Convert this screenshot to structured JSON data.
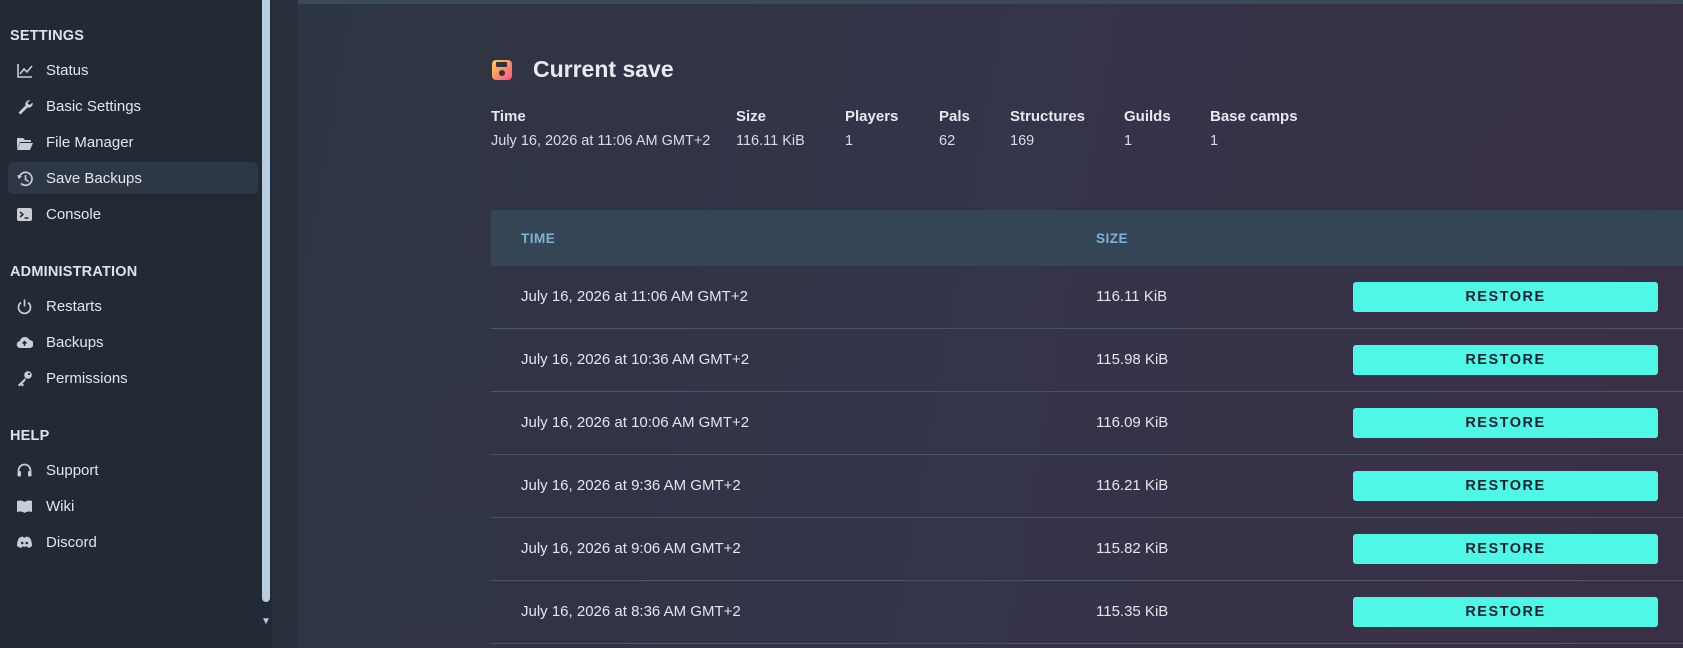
{
  "sidebar": {
    "sections": [
      {
        "title": "SETTINGS",
        "items": [
          {
            "label": "Status",
            "icon": "chart-line-icon"
          },
          {
            "label": "Basic Settings",
            "icon": "wrench-icon"
          },
          {
            "label": "File Manager",
            "icon": "folder-open-icon"
          },
          {
            "label": "Save Backups",
            "icon": "history-icon",
            "active": true
          },
          {
            "label": "Console",
            "icon": "terminal-icon"
          }
        ]
      },
      {
        "title": "ADMINISTRATION",
        "items": [
          {
            "label": "Restarts",
            "icon": "power-icon"
          },
          {
            "label": "Backups",
            "icon": "cloud-upload-icon"
          },
          {
            "label": "Permissions",
            "icon": "key-icon"
          }
        ]
      },
      {
        "title": "HELP",
        "items": [
          {
            "label": "Support",
            "icon": "headset-icon"
          },
          {
            "label": "Wiki",
            "icon": "book-icon"
          },
          {
            "label": "Discord",
            "icon": "discord-icon"
          }
        ]
      }
    ]
  },
  "current_save": {
    "title": "Current save",
    "stats": [
      {
        "label": "Time",
        "value": "July 16, 2026 at 11:06 AM GMT+2"
      },
      {
        "label": "Size",
        "value": "116.11 KiB"
      },
      {
        "label": "Players",
        "value": "1"
      },
      {
        "label": "Pals",
        "value": "62"
      },
      {
        "label": "Structures",
        "value": "169"
      },
      {
        "label": "Guilds",
        "value": "1"
      },
      {
        "label": "Base camps",
        "value": "1"
      }
    ]
  },
  "backups_table": {
    "columns": [
      "TIME",
      "SIZE"
    ],
    "action_label": "RESTORE",
    "rows": [
      {
        "time": "July 16, 2026 at 11:06 AM GMT+2",
        "size": "116.11 KiB"
      },
      {
        "time": "July 16, 2026 at 10:36 AM GMT+2",
        "size": "115.98 KiB"
      },
      {
        "time": "July 16, 2026 at 10:06 AM GMT+2",
        "size": "116.09 KiB"
      },
      {
        "time": "July 16, 2026 at 9:36 AM GMT+2",
        "size": "116.21 KiB"
      },
      {
        "time": "July 16, 2026 at 9:06 AM GMT+2",
        "size": "115.82 KiB"
      },
      {
        "time": "July 16, 2026 at 8:36 AM GMT+2",
        "size": "115.35 KiB"
      }
    ]
  },
  "colors": {
    "accent_button": "#4ff7e6",
    "table_header_bg": "#344655",
    "sidebar_bg": "#222a35"
  }
}
